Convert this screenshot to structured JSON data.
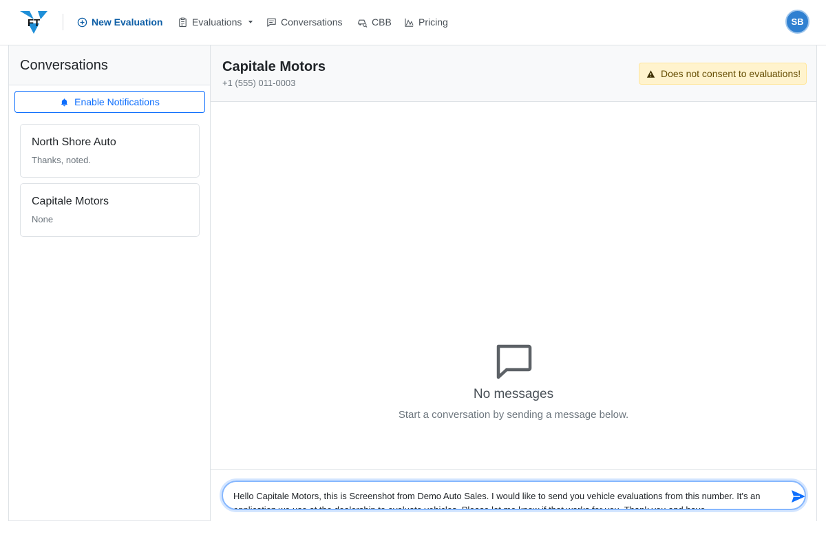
{
  "nav": {
    "logo_text": "FT",
    "new_evaluation": "New Evaluation",
    "evaluations": "Evaluations",
    "conversations": "Conversations",
    "cbb": "CBB",
    "pricing": "Pricing",
    "avatar_initials": "SB"
  },
  "sidebar": {
    "title": "Conversations",
    "enable_notifications": "Enable Notifications",
    "items": [
      {
        "name": "North Shore Auto",
        "preview": "Thanks, noted."
      },
      {
        "name": "Capitale Motors",
        "preview": "None"
      }
    ]
  },
  "chat": {
    "name": "Capitale Motors",
    "phone": "+1 (555) 011-0003",
    "warning": "Does not consent to evaluations!",
    "empty_title": "No messages",
    "empty_subtitle": "Start a conversation by sending a message below.",
    "message_draft": "Hello Capitale Motors, this is Screenshot from Demo Auto Sales. I would like to send you vehicle evaluations from this number. It's an application we use at the dealership to evaluate vehicles. Please let me know if that works for you. Thank you and have"
  },
  "colors": {
    "primary": "#0d6efd",
    "nav_primary": "#0d5ea6",
    "avatar": "#2f80d1",
    "warning_bg": "#fff3cd",
    "warning_text": "#664d03"
  },
  "icons": {
    "new_evaluation": "plus-circle-icon",
    "evaluations": "clipboard-icon",
    "dropdown": "caret-down-icon",
    "conversations": "chat-icon",
    "cbb": "car-search-icon",
    "pricing": "chart-line-icon",
    "notifications": "bell-icon",
    "warning": "warning-triangle-icon",
    "empty": "chat-square-icon",
    "send": "send-icon"
  }
}
